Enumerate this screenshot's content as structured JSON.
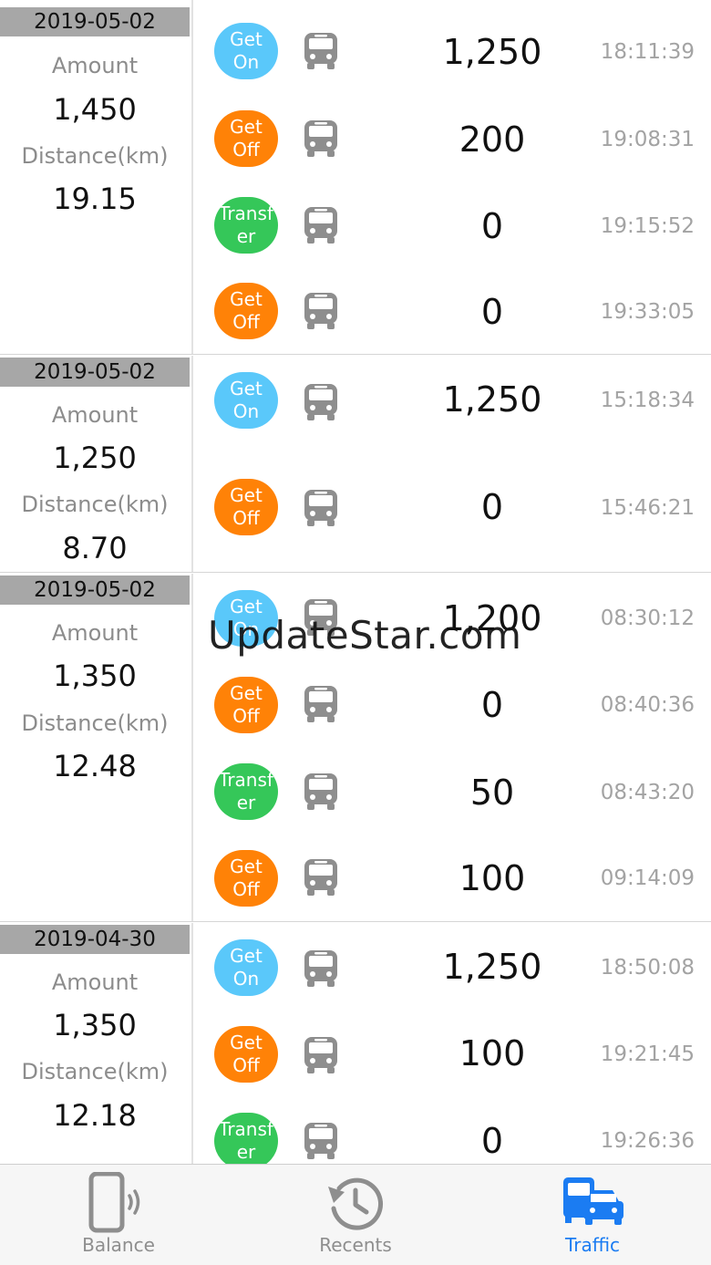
{
  "colors": {
    "get_on": "#5ac8fa",
    "get_off": "#ff8207",
    "transfer": "#35c759",
    "date_bar": "#a7a7a7",
    "tab_active": "#1b7cf2",
    "tab_inactive": "#8e8e8e"
  },
  "watermark": "UpdateStar.com",
  "days": [
    {
      "date": "2019-05-02",
      "amount_label": "Amount",
      "amount": "1,450",
      "distance_label": "Distance(km)",
      "distance": "19.15",
      "trips": [
        {
          "type": "get_on",
          "label": "Get\nOn",
          "amount": "1,250",
          "time": "18:11:39",
          "icon": "bus-front-icon"
        },
        {
          "type": "get_off",
          "label": "Get\nOff",
          "amount": "200",
          "time": "19:08:31",
          "icon": "bus-front-icon"
        },
        {
          "type": "transfer",
          "label": "Transf\ner",
          "amount": "0",
          "time": "19:15:52",
          "icon": "bus-front-icon"
        },
        {
          "type": "get_off",
          "label": "Get\nOff",
          "amount": "0",
          "time": "19:33:05",
          "icon": "bus-front-icon"
        }
      ]
    },
    {
      "date": "2019-05-02",
      "amount_label": "Amount",
      "amount": "1,250",
      "distance_label": "Distance(km)",
      "distance": "8.70",
      "trips": [
        {
          "type": "get_on",
          "label": "Get\nOn",
          "amount": "1,250",
          "time": "15:18:34",
          "icon": "bus-front-icon"
        },
        {
          "type": "get_off",
          "label": "Get\nOff",
          "amount": "0",
          "time": "15:46:21",
          "icon": "bus-front-icon"
        }
      ]
    },
    {
      "date": "2019-05-02",
      "amount_label": "Amount",
      "amount": "1,350",
      "distance_label": "Distance(km)",
      "distance": "12.48",
      "trips": [
        {
          "type": "get_on",
          "label": "Get\nOn",
          "amount": "1,200",
          "time": "08:30:12",
          "icon": "bus-front-icon"
        },
        {
          "type": "get_off",
          "label": "Get\nOff",
          "amount": "0",
          "time": "08:40:36",
          "icon": "bus-front-icon"
        },
        {
          "type": "transfer",
          "label": "Transf\ner",
          "amount": "50",
          "time": "08:43:20",
          "icon": "bus-front-icon"
        },
        {
          "type": "get_off",
          "label": "Get\nOff",
          "amount": "100",
          "time": "09:14:09",
          "icon": "bus-front-icon"
        }
      ]
    },
    {
      "date": "2019-04-30",
      "amount_label": "Amount",
      "amount": "1,350",
      "distance_label": "Distance(km)",
      "distance": "12.18",
      "trips": [
        {
          "type": "get_on",
          "label": "Get\nOn",
          "amount": "1,250",
          "time": "18:50:08",
          "icon": "bus-front-icon"
        },
        {
          "type": "get_off",
          "label": "Get\nOff",
          "amount": "100",
          "time": "19:21:45",
          "icon": "bus-front-icon"
        },
        {
          "type": "transfer",
          "label": "Transf\ner",
          "amount": "0",
          "time": "19:26:36",
          "icon": "bus-front-icon"
        }
      ]
    }
  ],
  "tabs": [
    {
      "label": "Balance",
      "icon": "phone-card-icon",
      "active": false
    },
    {
      "label": "Recents",
      "icon": "history-icon",
      "active": false
    },
    {
      "label": "Traffic",
      "icon": "transit-icon",
      "active": true
    }
  ]
}
